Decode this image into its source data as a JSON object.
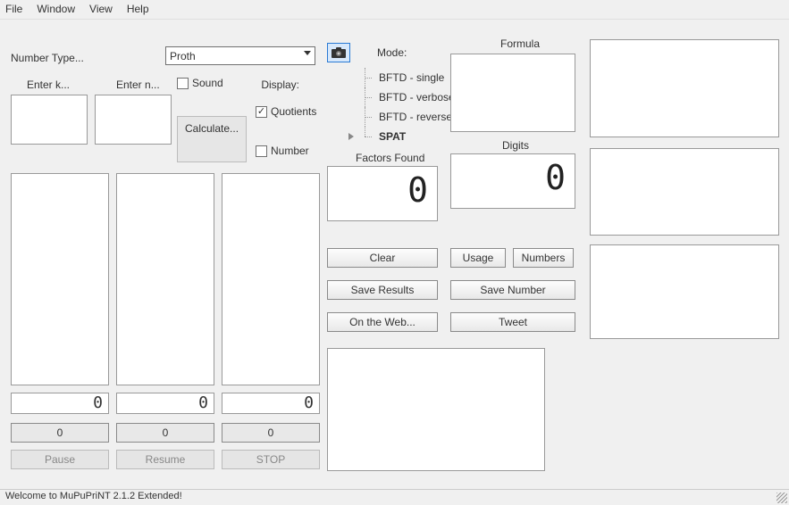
{
  "menu": {
    "file": "File",
    "window": "Window",
    "view": "View",
    "help": "Help"
  },
  "left": {
    "numberTypeLabel": "Number Type...",
    "numberTypeValue": "Proth",
    "enterK": "Enter k...",
    "enterN": "Enter n...",
    "soundLabel": "Sound",
    "displayLabel": "Display:",
    "calculate": "Calculate...",
    "quotients": "Quotients",
    "number": "Number",
    "seg1": "0",
    "seg2": "0",
    "seg3": "0",
    "zero1": "0",
    "zero2": "0",
    "zero3": "0",
    "pause": "Pause",
    "resume": "Resume",
    "stop": "STOP"
  },
  "mode": {
    "label": "Mode:",
    "items": [
      "BFTD - single",
      "BFTD - verbose",
      "BFTD - reverse",
      "SPAT"
    ],
    "selectedIndex": 3
  },
  "center": {
    "factorsLabel": "Factors Found",
    "factorsValue": "0",
    "formulaLabel": "Formula",
    "digitsLabel": "Digits",
    "digitsValue": "0"
  },
  "buttons": {
    "clear": "Clear",
    "usage": "Usage",
    "numbers": "Numbers",
    "saveResults": "Save Results",
    "saveNumber": "Save Number",
    "onWeb": "On the Web...",
    "tweet": "Tweet"
  },
  "status": "Welcome to MuPuPriNT 2.1.2 Extended!",
  "icons": {
    "camera": "camera-icon"
  }
}
